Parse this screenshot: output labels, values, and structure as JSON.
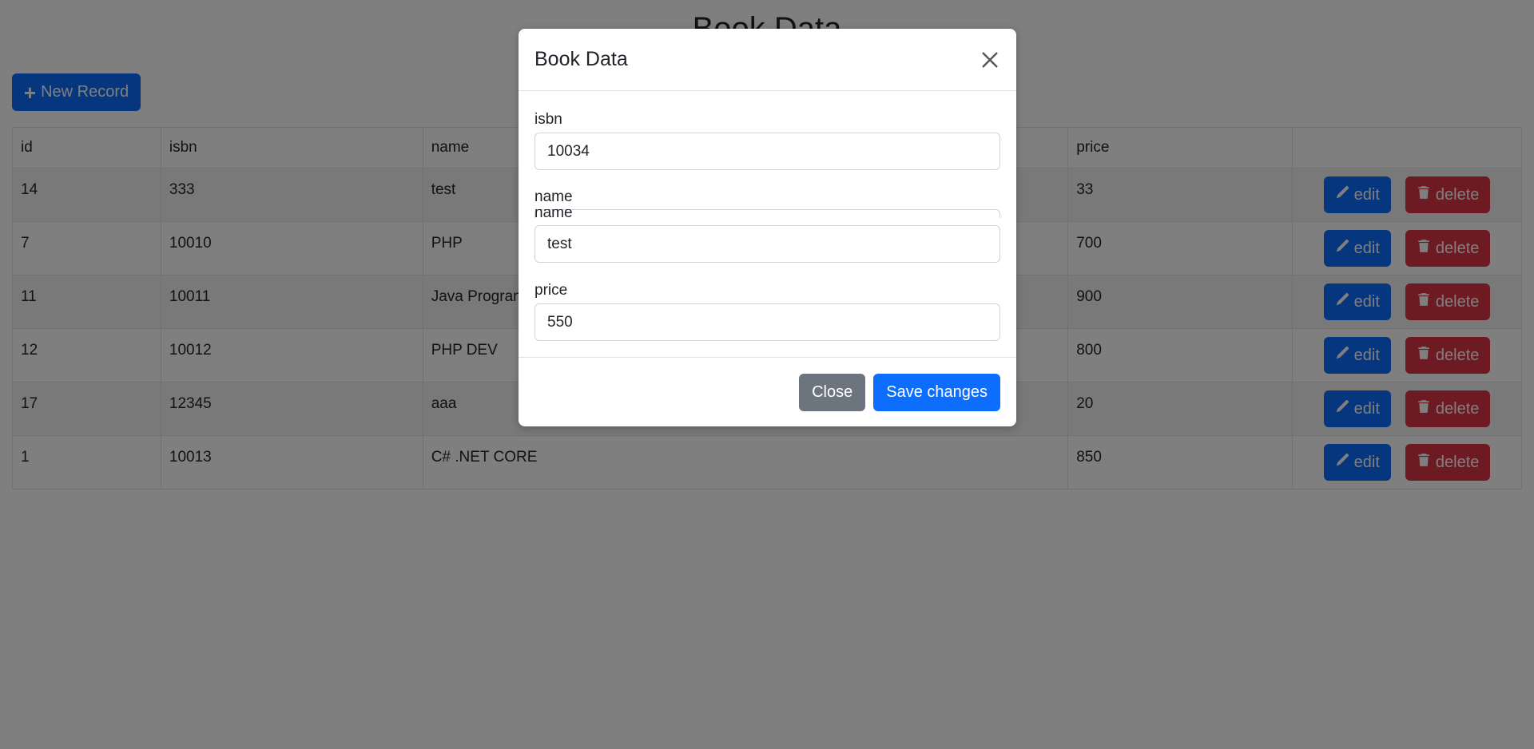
{
  "page": {
    "title": "Book Data",
    "new_record_label": "New Record",
    "new_record_icon": "plus-icon"
  },
  "table": {
    "columns": [
      "id",
      "isbn",
      "name",
      "price",
      ""
    ],
    "rows": [
      {
        "id": "14",
        "isbn": "333",
        "name": "test",
        "price": "33"
      },
      {
        "id": "7",
        "isbn": "10010",
        "name": "PHP",
        "price": "700"
      },
      {
        "id": "11",
        "isbn": "10011",
        "name": "Java Programming",
        "price": "900"
      },
      {
        "id": "12",
        "isbn": "10012",
        "name": "PHP DEV",
        "price": "800"
      },
      {
        "id": "17",
        "isbn": "12345",
        "name": "aaa",
        "price": "20"
      },
      {
        "id": "1",
        "isbn": "10013",
        "name": "C# .NET CORE",
        "price": "850"
      }
    ],
    "edit_label": "edit",
    "delete_label": "delete",
    "edit_icon": "pencil-icon",
    "delete_icon": "trash-icon"
  },
  "modal": {
    "title": "Book Data",
    "fields": {
      "isbn_label": "isbn",
      "isbn_value": "10034",
      "name_label": "name",
      "name_ghost_label": "name",
      "name_value": "test",
      "price_label": "price",
      "price_value": "550"
    },
    "close_label": "Close",
    "save_label": "Save changes"
  },
  "colors": {
    "primary": "#0d6efd",
    "danger": "#dc3545",
    "secondary": "#6c757d",
    "backdrop": "rgba(0,0,0,0.5)"
  }
}
